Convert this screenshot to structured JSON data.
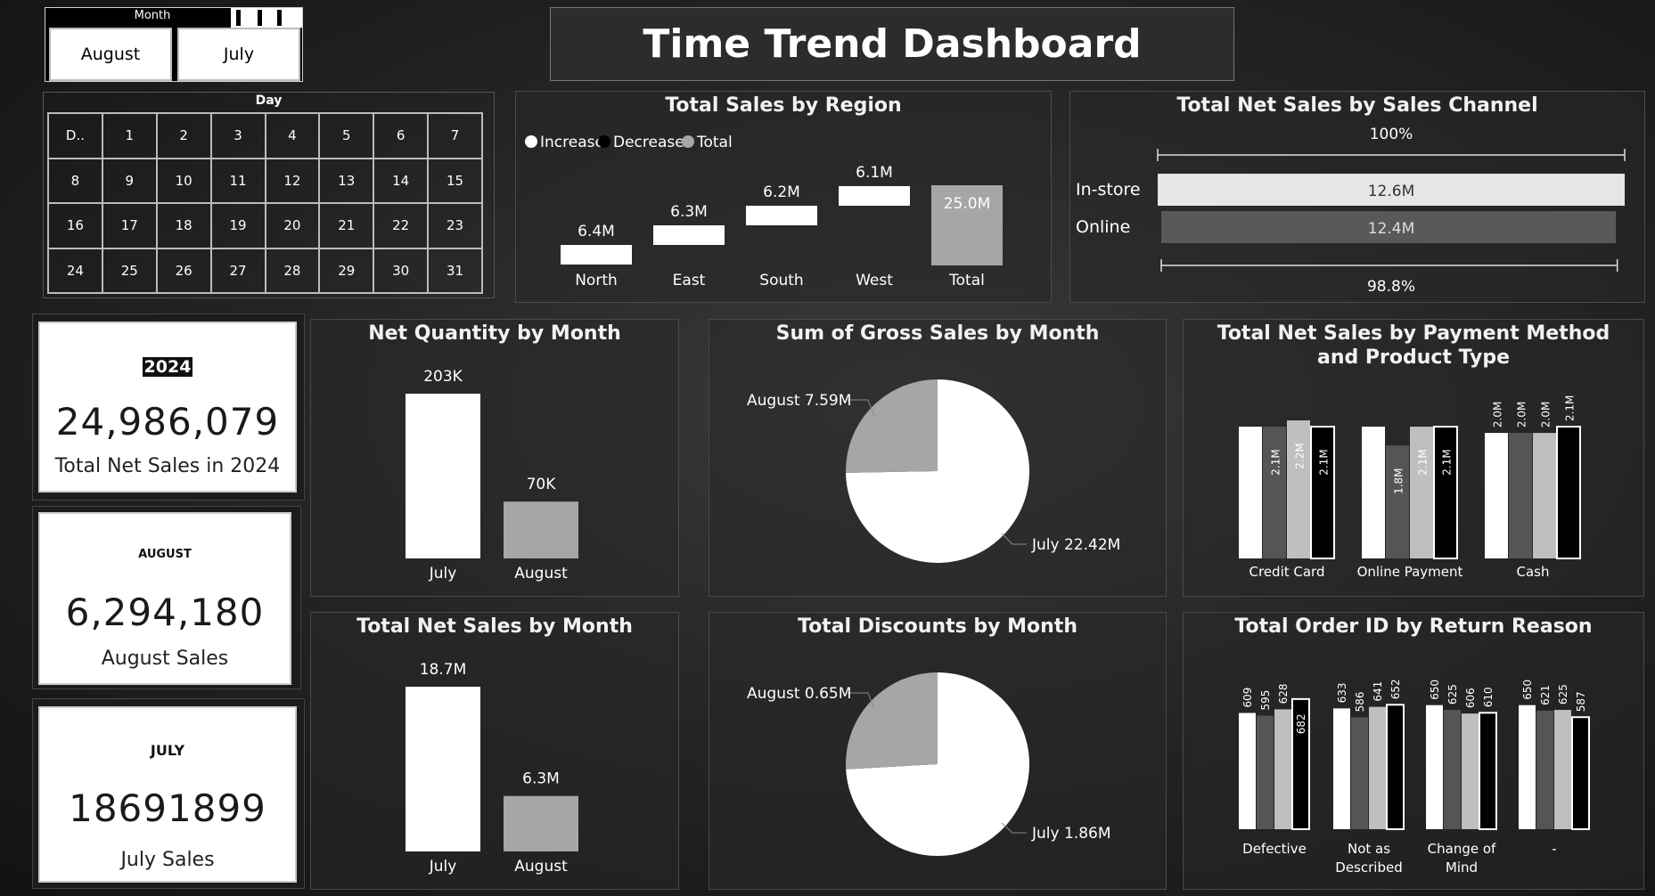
{
  "title": "Time Trend Dashboard",
  "month_slicer": {
    "header": "Month",
    "options": [
      "August",
      "July"
    ]
  },
  "day_slicer": {
    "header": "Day",
    "cells": [
      "D..",
      "1",
      "2",
      "3",
      "4",
      "5",
      "6",
      "7",
      "8",
      "9",
      "10",
      "11",
      "12",
      "13",
      "14",
      "15",
      "16",
      "17",
      "18",
      "19",
      "20",
      "21",
      "22",
      "23",
      "24",
      "25",
      "26",
      "27",
      "28",
      "29",
      "30",
      "31"
    ]
  },
  "kpis": {
    "year": {
      "tag": "2024",
      "value": "24,986,079",
      "label": "Total Net Sales in 2024"
    },
    "august": {
      "tag": "AUGUST",
      "value": "6,294,180",
      "label": "August Sales"
    },
    "july": {
      "tag": "JULY",
      "value": "18691899",
      "label": "July Sales"
    }
  },
  "colors": {
    "white": "#ffffff",
    "gray": "#a6a6a6",
    "dark_gray": "#555555",
    "light_gray": "#bfbfbf",
    "black": "#000000"
  },
  "chart_data": [
    {
      "id": "region",
      "type": "waterfall",
      "title": "Total Sales by Region",
      "legend": [
        "Increase",
        "Decrease",
        "Total"
      ],
      "categories": [
        "North",
        "East",
        "South",
        "West",
        "Total"
      ],
      "values": [
        6.4,
        6.3,
        6.2,
        6.1,
        25.0
      ],
      "labels": [
        "6.4M",
        "6.3M",
        "6.2M",
        "6.1M",
        "25.0M"
      ]
    },
    {
      "id": "channel",
      "type": "bar",
      "orientation": "horizontal",
      "title": "Total Net Sales by Sales Channel",
      "categories": [
        "In-store",
        "Online"
      ],
      "values": [
        12.6,
        12.4
      ],
      "labels": [
        "12.6M",
        "12.4M"
      ],
      "percent_labels": [
        "100%",
        "98.8%"
      ]
    },
    {
      "id": "net_quantity",
      "type": "bar",
      "title": "Net Quantity by Month",
      "categories": [
        "July",
        "August"
      ],
      "values": [
        203,
        70
      ],
      "labels": [
        "203K",
        "70K"
      ]
    },
    {
      "id": "gross_sales",
      "type": "pie",
      "title": "Sum of Gross Sales by Month",
      "categories": [
        "August",
        "July"
      ],
      "values": [
        7.59,
        22.42
      ],
      "labels": [
        "August 7.59M",
        "July 22.42M"
      ]
    },
    {
      "id": "payment",
      "type": "bar",
      "title": "Total Net Sales by Payment Method and Product Type",
      "categories": [
        "Credit Card",
        "Online Payment",
        "Cash"
      ],
      "series": [
        {
          "values": [
            2.1,
            2.1,
            2.0
          ]
        },
        {
          "values": [
            2.1,
            1.8,
            2.0
          ]
        },
        {
          "values": [
            2.2,
            2.1,
            2.0
          ]
        },
        {
          "values": [
            2.1,
            2.1,
            2.1
          ]
        }
      ],
      "label_matrix": [
        [
          "",
          "2.1M",
          "2.2M",
          "2.1M"
        ],
        [
          "",
          "1.8M",
          "2.1M",
          "2.1M"
        ],
        [
          "2.0M",
          "2.0M",
          "2.0M",
          "2.1M"
        ]
      ]
    },
    {
      "id": "net_sales_month",
      "type": "bar",
      "title": "Total Net Sales by Month",
      "categories": [
        "July",
        "August"
      ],
      "values": [
        18.7,
        6.3
      ],
      "labels": [
        "18.7M",
        "6.3M"
      ]
    },
    {
      "id": "discounts",
      "type": "pie",
      "title": "Total Discounts by Month",
      "categories": [
        "August",
        "July"
      ],
      "values": [
        0.65,
        1.86
      ],
      "labels": [
        "August 0.65M",
        "July 1.86M"
      ]
    },
    {
      "id": "returns",
      "type": "bar",
      "title": "Total Order ID by Return Reason",
      "categories": [
        "Defective",
        "Not as Described",
        "Change of Mind",
        "-"
      ],
      "category_lines": [
        [
          "Defective"
        ],
        [
          "Not as",
          "Described"
        ],
        [
          "Change of",
          "Mind"
        ],
        [
          "-"
        ]
      ],
      "series": [
        {
          "values": [
            609,
            633,
            650,
            650
          ]
        },
        {
          "values": [
            595,
            586,
            625,
            621
          ]
        },
        {
          "values": [
            628,
            641,
            606,
            625
          ]
        },
        {
          "values": [
            682,
            652,
            610,
            587
          ]
        }
      ]
    }
  ]
}
